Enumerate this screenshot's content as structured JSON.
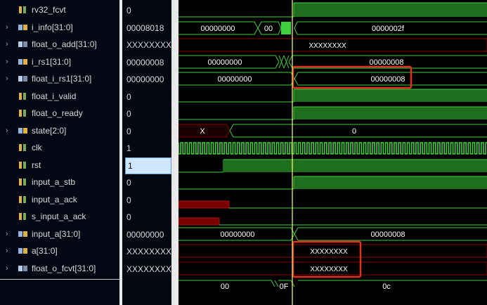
{
  "signals": [
    {
      "name": "rv32_fcvt",
      "value": "0",
      "icon": "bit-icon",
      "expandable": false
    },
    {
      "name": "i_info[31:0]",
      "value": "00008018",
      "icon": "bus-icon",
      "expandable": true
    },
    {
      "name": "float_o_add[31:0]",
      "value": "XXXXXXXX",
      "icon": "float-bus-icon",
      "expandable": true
    },
    {
      "name": "i_rs1[31:0]",
      "value": "00000008",
      "icon": "bus-icon",
      "expandable": true
    },
    {
      "name": "float_i_rs1[31:0]",
      "value": "00000000",
      "icon": "float-bus-icon",
      "expandable": true
    },
    {
      "name": "float_i_valid",
      "value": "0",
      "icon": "bit-icon",
      "expandable": false
    },
    {
      "name": "float_o_ready",
      "value": "0",
      "icon": "bit-icon",
      "expandable": false
    },
    {
      "name": "state[2:0]",
      "value": "0",
      "icon": "bus-icon",
      "expandable": true
    },
    {
      "name": "clk",
      "value": "1",
      "icon": "bit-icon",
      "expandable": false
    },
    {
      "name": "rst",
      "value": "1",
      "icon": "bit-icon",
      "expandable": false,
      "selected": true
    },
    {
      "name": "input_a_stb",
      "value": "0",
      "icon": "bit-icon",
      "expandable": false
    },
    {
      "name": "input_a_ack",
      "value": "0",
      "icon": "bit-icon",
      "expandable": false
    },
    {
      "name": "s_input_a_ack",
      "value": "0",
      "icon": "bit-icon",
      "expandable": false
    },
    {
      "name": "input_a[31:0]",
      "value": "00000000",
      "icon": "bus-icon",
      "expandable": true
    },
    {
      "name": "a[31:0]",
      "value": "XXXXXXXX",
      "icon": "bus-icon",
      "expandable": true
    },
    {
      "name": "float_o_fcvt[31:0]",
      "value": "XXXXXXXX",
      "icon": "float-bus-icon",
      "expandable": true
    }
  ],
  "wave_labels": {
    "i_info_a": "00000000",
    "i_info_b": "00",
    "i_info_c": "0000002f",
    "float_o_add": "XXXXXXXX",
    "i_rs1_a": "00000000",
    "i_rs1_b": "00000008",
    "float_i_rs1_a": "00000000",
    "float_i_rs1_b": "00000008",
    "state_a": "X",
    "state_b": "0",
    "input_a_a": "00000000",
    "input_a_b": "00000008",
    "a_val": "XXXXXXXX",
    "fcvt_val": "XXXXXXXX",
    "bottom_a": "00",
    "bottom_b": "0F",
    "bottom_c": "0c"
  },
  "colors": {
    "wave": "#3fcf3f",
    "wave_fill": "#1e6e1e",
    "x_state": "#8b0000",
    "cursor": "#ffff66",
    "highlight_box": "#e03020"
  }
}
